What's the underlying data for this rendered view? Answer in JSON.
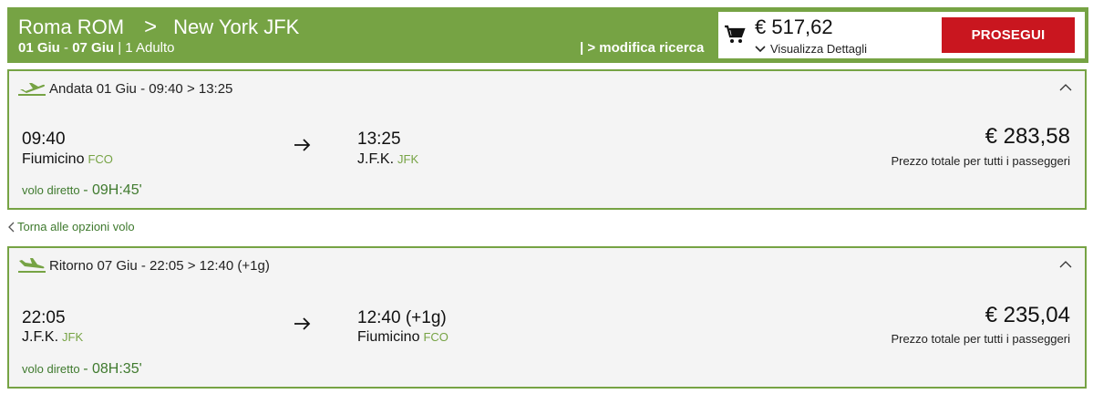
{
  "header": {
    "origin": "Roma ROM",
    "separator": ">",
    "destination": "New York JFK",
    "date_out": "01 Giu",
    "date_dash": " - ",
    "date_back": "07 Giu",
    "passengers": " | 1 Adulto",
    "modify": "| > modifica ricerca",
    "color_brand": "#76a344"
  },
  "cart": {
    "icon": "cart-icon",
    "total": "€ 517,62",
    "details": "Visualizza Dettagli",
    "proceed": "PROSEGUI",
    "proceed_color": "#c9161f"
  },
  "outbound": {
    "icon": "plane-takeoff-icon",
    "heading": "Andata 01 Giu - 09:40 > 13:25",
    "dep_time": "09:40",
    "dep_airport": "Fiumicino",
    "dep_code": "FCO",
    "arr_time": "13:25",
    "arr_airport": "J.F.K.",
    "arr_code": "JFK",
    "price": "€ 283,58",
    "price_note": "Prezzo totale per tutti i passeggeri",
    "direct_label": "volo diretto",
    "duration": "- 09H:45'"
  },
  "back_link": "Torna alle opzioni volo",
  "return": {
    "icon": "plane-landing-icon",
    "heading": "Ritorno 07 Giu - 22:05 > 12:40 (+1g)",
    "dep_time": "22:05",
    "dep_airport": "J.F.K.",
    "dep_code": "JFK",
    "arr_time": "12:40 (+1g)",
    "arr_airport": "Fiumicino",
    "arr_code": "FCO",
    "price": "€ 235,04",
    "price_note": "Prezzo totale per tutti i passeggeri",
    "direct_label": "volo diretto",
    "duration": "- 08H:35'"
  }
}
